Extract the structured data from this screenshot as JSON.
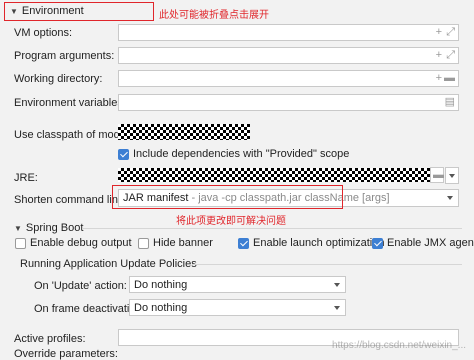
{
  "environment_section": {
    "title": "Environment",
    "annotation": "此处可能被折叠点击展开"
  },
  "fields": {
    "vm_options": "VM options:",
    "program_arguments": "Program arguments:",
    "working_directory": "Working directory:",
    "environment_variables": "Environment variables:",
    "use_classpath": "Use classpath of module:",
    "include_deps": "Include dependencies with \"Provided\" scope",
    "jre": "JRE:",
    "shorten_command_line": "Shorten command line:"
  },
  "shorten": {
    "value_main": "JAR manifest",
    "value_hint": " - java -cp classpath.jar className [args]",
    "annotation": "将此项更改即可解决问题"
  },
  "icons": {
    "plus": "+",
    "expand": "⤢",
    "folder": "▬",
    "doc": "▤"
  },
  "spring_boot": {
    "title": "Spring Boot",
    "debug_output": "Enable debug output",
    "hide_banner": "Hide banner",
    "launch_optimization": "Enable launch optimization",
    "jmx_agent": "Enable JMX agent",
    "update_policies_title": "Running Application Update Policies",
    "on_update_label": "On 'Update' action:",
    "on_update_value": "Do nothing",
    "on_frame_label": "On frame deactivation:",
    "on_frame_value": "Do nothing"
  },
  "bottom": {
    "active_profiles": "Active profiles:",
    "override_parameters": "Override parameters:"
  },
  "watermark": "https://blog.csdn.net/weixin_..."
}
